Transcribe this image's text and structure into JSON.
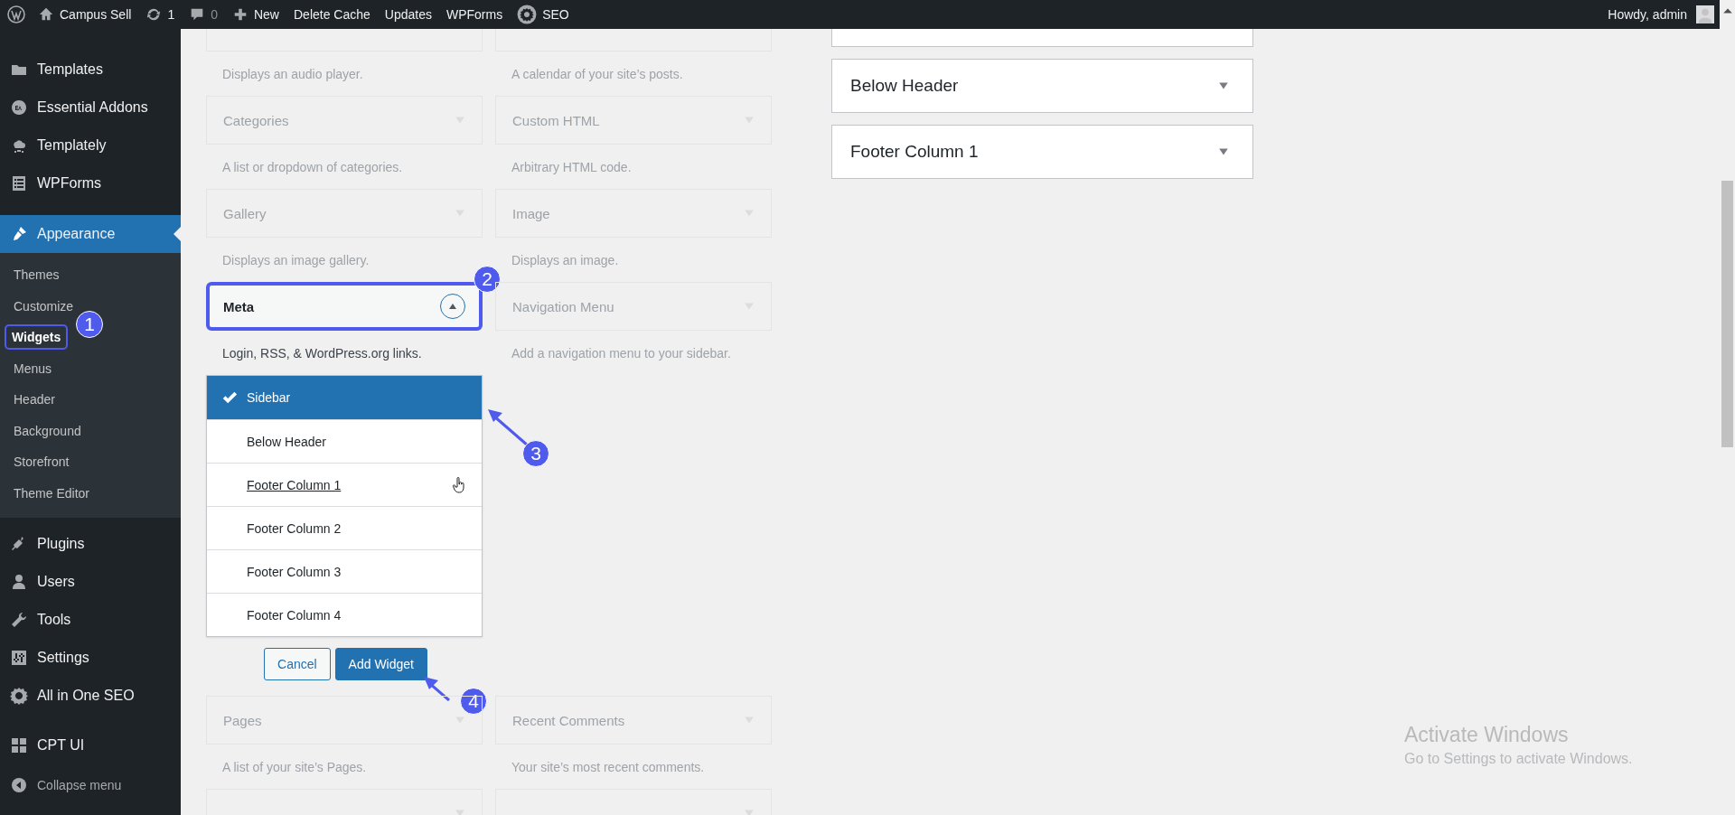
{
  "admin_bar": {
    "items": [
      {
        "kind": "wp-logo"
      },
      {
        "kind": "home",
        "label": "Campus Sell"
      },
      {
        "kind": "updates",
        "label": "1"
      },
      {
        "kind": "comments",
        "label": "0"
      },
      {
        "kind": "new",
        "label": "New"
      },
      {
        "kind": "text",
        "label": "Delete Cache"
      },
      {
        "kind": "text",
        "label": "Updates"
      },
      {
        "kind": "text",
        "label": "WPForms"
      },
      {
        "kind": "seo",
        "label": "SEO"
      }
    ],
    "account": "Howdy, admin"
  },
  "sidebar": {
    "items": [
      {
        "label": "Templates",
        "selected": false
      },
      {
        "label": "Essential Addons",
        "selected": false
      },
      {
        "label": "Templately",
        "selected": false
      },
      {
        "label": "WPForms",
        "selected": false
      },
      {
        "label": "Appearance",
        "selected": true,
        "children": [
          {
            "label": "Themes",
            "selected": false
          },
          {
            "label": "Customize",
            "selected": false
          },
          {
            "label": "Widgets",
            "selected": true,
            "callout": "1"
          },
          {
            "label": "Menus",
            "selected": false
          },
          {
            "label": "Header",
            "selected": false
          },
          {
            "label": "Background",
            "selected": false
          },
          {
            "label": "Storefront",
            "selected": false
          },
          {
            "label": "Theme Editor",
            "selected": false
          }
        ]
      },
      {
        "label": "Plugins",
        "selected": false
      },
      {
        "label": "Users",
        "selected": false
      },
      {
        "label": "Tools",
        "selected": false
      },
      {
        "label": "Settings",
        "selected": false
      },
      {
        "label": "All in One SEO",
        "selected": false
      },
      {
        "label": "CPT UI",
        "selected": false
      }
    ],
    "collapse": "Collapse menu"
  },
  "widgets": [
    {
      "kind": "cut",
      "description": "Displays an audio player.",
      "disabled": true
    },
    {
      "kind": "cut",
      "description": "A calendar of your site’s posts.",
      "disabled": true
    },
    {
      "kind": "widget",
      "title": "Categories",
      "description": "A list or dropdown of categories.",
      "disabled": true,
      "expanded": false
    },
    {
      "kind": "widget",
      "title": "Custom HTML",
      "description": "Arbitrary HTML code.",
      "disabled": true,
      "expanded": false
    },
    {
      "kind": "widget",
      "title": "Gallery",
      "description": "Displays an image gallery.",
      "disabled": true,
      "expanded": false
    },
    {
      "kind": "widget",
      "title": "Image",
      "description": "Displays an image.",
      "disabled": true,
      "expanded": false
    },
    {
      "kind": "widget",
      "title": "Meta",
      "description": "Login, RSS, & WordPress.org links.",
      "disabled": false,
      "expanded": true,
      "callout": "2"
    },
    {
      "kind": "widget",
      "title": "Navigation Menu",
      "description": "Add a navigation menu to your sidebar.",
      "disabled": true,
      "expanded": false
    },
    {
      "kind": "widget",
      "title": "Pages",
      "description": "A list of your site’s Pages.",
      "disabled": true,
      "expanded": false
    },
    {
      "kind": "widget",
      "title": "Recent Comments",
      "description": "Your site’s most recent comments.",
      "disabled": true,
      "expanded": false
    },
    {
      "kind": "cut-end"
    },
    {
      "kind": "cut-end"
    }
  ],
  "chooser": {
    "callout": "3",
    "areas": [
      {
        "label": "Sidebar",
        "selected": true,
        "hovered": false
      },
      {
        "label": "Below Header",
        "selected": false,
        "hovered": false
      },
      {
        "label": "Footer Column 1",
        "selected": false,
        "hovered": true
      },
      {
        "label": "Footer Column 2",
        "selected": false,
        "hovered": false
      },
      {
        "label": "Footer Column 3",
        "selected": false,
        "hovered": false
      },
      {
        "label": "Footer Column 4",
        "selected": false,
        "hovered": false
      }
    ],
    "buttons": [
      {
        "kind": "secondary",
        "label": "Cancel"
      },
      {
        "kind": "primary",
        "label": "Add Widget",
        "callout": "4"
      }
    ]
  },
  "widget_areas": [
    {
      "kind": "cut"
    },
    {
      "kind": "area",
      "title": "Below Header",
      "expanded": false
    },
    {
      "kind": "area",
      "title": "Footer Column 1",
      "expanded": false
    }
  ],
  "activation_notice": {
    "title": "Activate Windows",
    "text": "Go to Settings to activate Windows."
  }
}
